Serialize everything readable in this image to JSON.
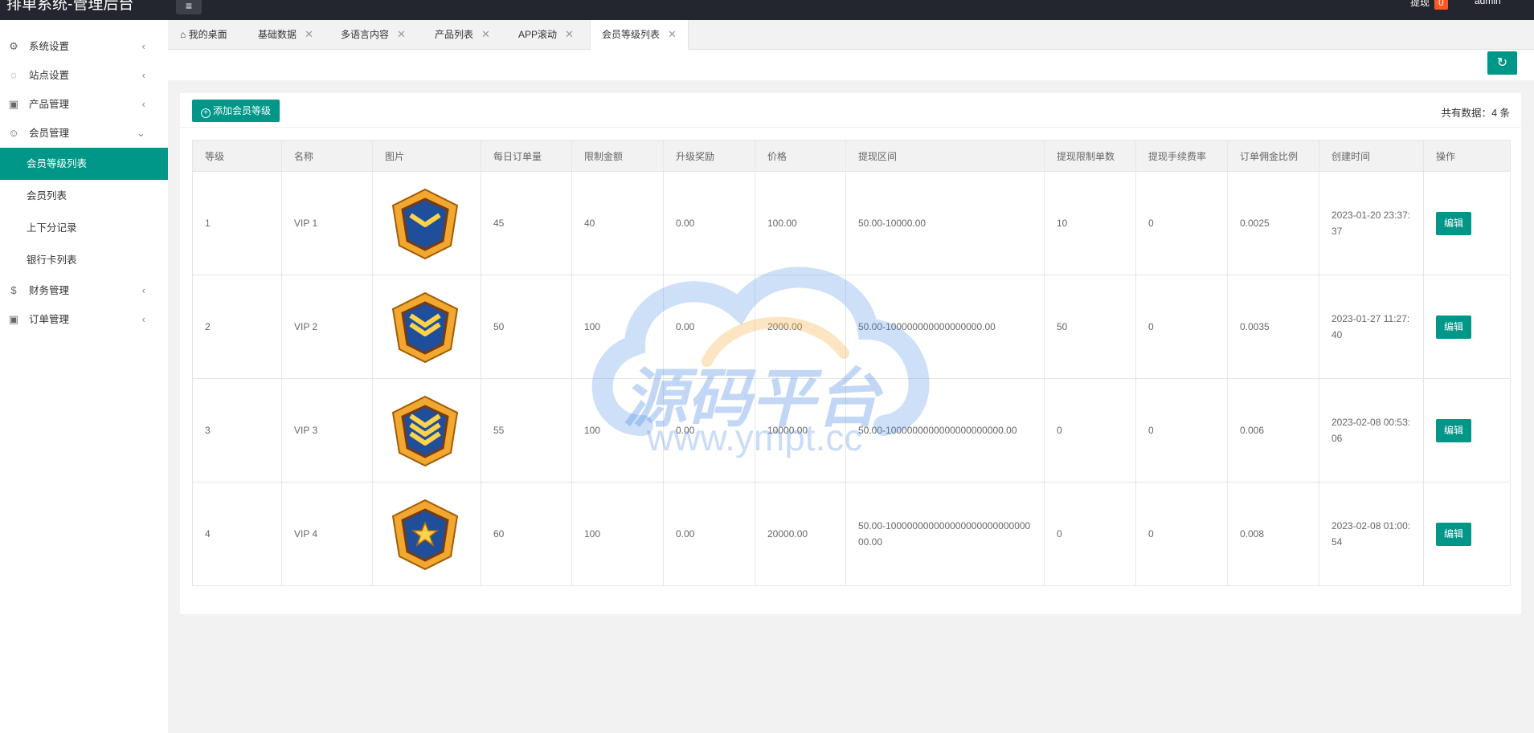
{
  "header": {
    "title": "排单系统-管理后台",
    "menu_icon": "≡",
    "withdraw_label": "提现",
    "withdraw_count": "0",
    "user": "admin"
  },
  "sidebar": {
    "groups": [
      {
        "label": "系统设置",
        "icon": "gear-icon"
      },
      {
        "label": "站点设置",
        "icon": "globe-icon"
      },
      {
        "label": "产品管理",
        "icon": "box-icon"
      },
      {
        "label": "会员管理",
        "icon": "user-icon"
      },
      {
        "label": "财务管理",
        "icon": "dollar-icon"
      },
      {
        "label": "订单管理",
        "icon": "box-icon"
      }
    ],
    "member_sub": [
      "会员等级列表",
      "会员列表",
      "上下分记录",
      "银行卡列表"
    ]
  },
  "tabs": [
    {
      "label": "我的桌面",
      "icon": "home-icon"
    },
    {
      "label": "基础数据"
    },
    {
      "label": "多语言内容"
    },
    {
      "label": "产品列表"
    },
    {
      "label": "APP滚动"
    },
    {
      "label": "会员等级列表"
    }
  ],
  "toolbar": {
    "refresh_icon": "↻"
  },
  "card": {
    "add_label": "添加会员等级",
    "total_label": "共有数据：",
    "total_value": "4 条"
  },
  "table": {
    "columns": [
      "等级",
      "名称",
      "图片",
      "每日订单量",
      "限制金额",
      "升级奖励",
      "价格",
      "提现区间",
      "提现限制单数",
      "提现手续费率",
      "订单佣金比例",
      "创建时间",
      "操作"
    ],
    "rows": [
      {
        "level": "1",
        "name": "VIP 1",
        "daily": "45",
        "limit": "40",
        "bonus": "0.00",
        "price": "100.00",
        "range": "50.00-10000.00",
        "wd_count": "10",
        "fee": "0",
        "commission": "0.0025",
        "created": "2023-01-20 23:37:37",
        "action": "编辑",
        "chevrons": 1,
        "star": false
      },
      {
        "level": "2",
        "name": "VIP 2",
        "daily": "50",
        "limit": "100",
        "bonus": "0.00",
        "price": "2000.00",
        "range": "50.00-100000000000000000.00",
        "wd_count": "50",
        "fee": "0",
        "commission": "0.0035",
        "created": "2023-01-27 11:27:40",
        "action": "编辑",
        "chevrons": 2,
        "star": false
      },
      {
        "level": "3",
        "name": "VIP 3",
        "daily": "55",
        "limit": "100",
        "bonus": "0.00",
        "price": "10000.00",
        "range": "50.00-1000000000000000000000.00",
        "wd_count": "0",
        "fee": "0",
        "commission": "0.006",
        "created": "2023-02-08 00:53:06",
        "action": "编辑",
        "chevrons": 3,
        "star": false
      },
      {
        "level": "4",
        "name": "VIP 4",
        "daily": "60",
        "limit": "100",
        "bonus": "0.00",
        "price": "20000.00",
        "range": "50.00-10000000000000000000000000000.00",
        "wd_count": "0",
        "fee": "0",
        "commission": "0.008",
        "created": "2023-02-08 01:00:54",
        "action": "编辑",
        "chevrons": 0,
        "star": true
      }
    ]
  },
  "watermark": {
    "text": "源码平台",
    "url": "www.ympt.cc"
  },
  "colors": {
    "accent": "#009688",
    "header": "#23262e",
    "badge": "#ff5722",
    "medal_gold": "#f0a830",
    "medal_blue": "#1f4f9a"
  }
}
